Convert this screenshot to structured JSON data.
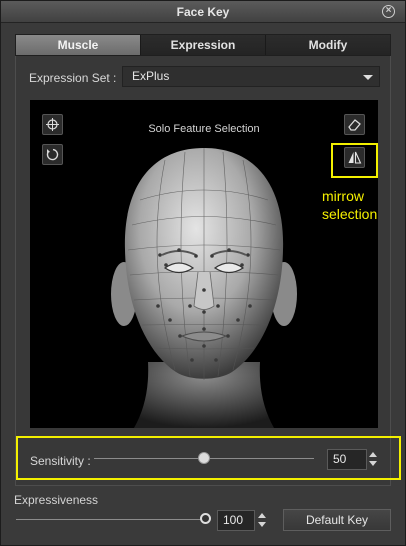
{
  "window": {
    "title": "Face Key",
    "close_icon": "close-circle-icon"
  },
  "tabs": [
    {
      "label": "Muscle",
      "active": true
    },
    {
      "label": "Expression",
      "active": false
    },
    {
      "label": "Modify",
      "active": false
    }
  ],
  "expression_set": {
    "label": "Expression Set :",
    "value": "ExPlus"
  },
  "viewport": {
    "title": "Solo Feature Selection",
    "tools": [
      "rotate-view-icon",
      "reset-icon",
      "eraser-icon",
      "mirror-icon"
    ]
  },
  "annotation": {
    "line1": "mirrow",
    "line2": "selection",
    "color": "#f3f000"
  },
  "sensitivity": {
    "label": "Sensitivity :",
    "value": "50",
    "fraction": 0.5
  },
  "expressiveness": {
    "label": "Expressiveness",
    "value": "100",
    "fraction": 1.0
  },
  "default_key_label": "Default Key"
}
